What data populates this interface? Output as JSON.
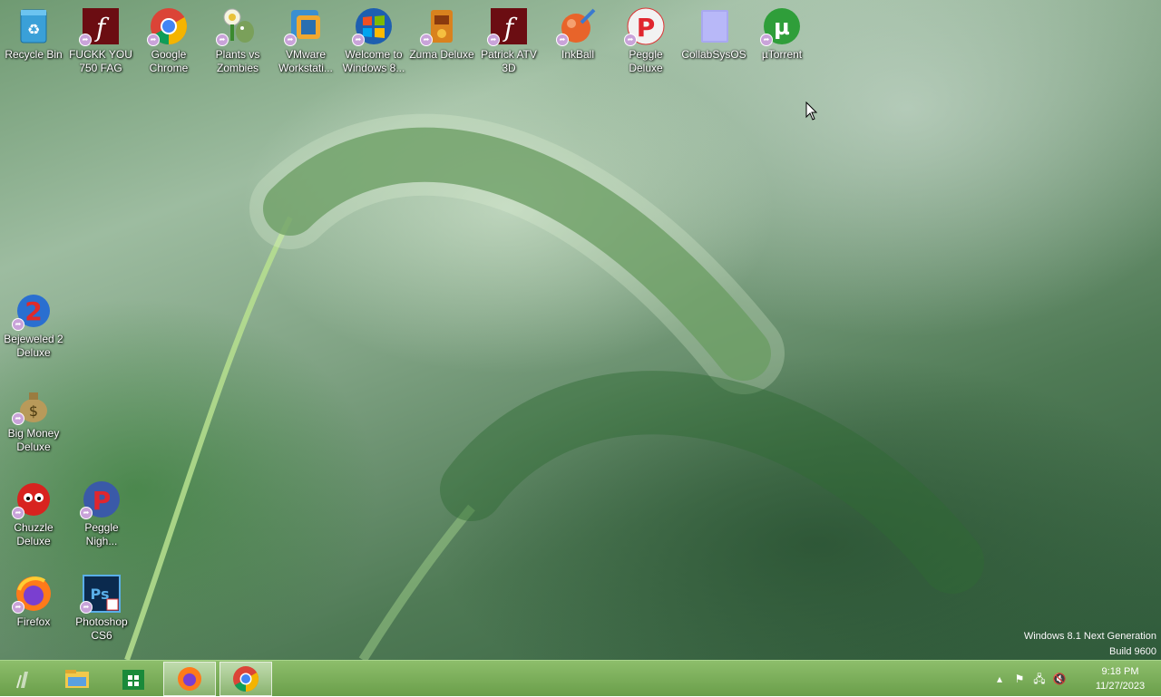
{
  "desktop": {
    "icons": [
      {
        "label": "Recycle Bin",
        "icon": "recycle-bin-icon"
      },
      {
        "label": "FUCKK YOU\n750 FAG",
        "icon": "flash-icon"
      },
      {
        "label": "Google\nChrome",
        "icon": "chrome-icon"
      },
      {
        "label": "Plants vs\nZombies",
        "icon": "plants-vs-zombies-icon"
      },
      {
        "label": "VMware\nWorkstati...",
        "icon": "vmware-icon"
      },
      {
        "label": "Welcome to\nWindows 8...",
        "icon": "windows-logo-icon"
      },
      {
        "label": "Zuma Deluxe",
        "icon": "zuma-icon"
      },
      {
        "label": "Patrick ATV\n3D",
        "icon": "flash-icon"
      },
      {
        "label": "InkBall",
        "icon": "inkball-icon"
      },
      {
        "label": "Peggle\nDeluxe",
        "icon": "peggle-icon"
      },
      {
        "label": "CollabSysOS",
        "icon": "folder-icon"
      },
      {
        "label": "µTorrent",
        "icon": "utorrent-icon"
      },
      {
        "label": "Bejeweled 2\nDeluxe",
        "icon": "bejeweled-icon"
      },
      {
        "label": "Big Money\nDeluxe",
        "icon": "money-bag-icon"
      },
      {
        "label": "Chuzzle\nDeluxe",
        "icon": "chuzzle-icon"
      },
      {
        "label": "Peggle\nNigh...",
        "icon": "peggle-icon"
      },
      {
        "label": "Firefox",
        "icon": "firefox-icon"
      },
      {
        "label": "Photoshop\nCS6",
        "icon": "photoshop-icon"
      }
    ]
  },
  "watermark": {
    "line1": "Windows 8.1 Next Generation",
    "line2": "Build 9600"
  },
  "taskbar": {
    "start_icon": "start-orb-icon",
    "pinned": [
      {
        "name": "file-explorer",
        "icon": "folder-icon",
        "active": false
      },
      {
        "name": "store",
        "icon": "store-icon",
        "active": false
      },
      {
        "name": "firefox",
        "icon": "firefox-icon",
        "active": true
      },
      {
        "name": "chrome",
        "icon": "chrome-icon",
        "active": true
      }
    ],
    "tray": {
      "icons": [
        "show-hidden-icon",
        "flag-icon",
        "network-icon",
        "volume-muted-icon"
      ]
    },
    "clock": {
      "time": "9:18 PM",
      "date": "11/27/2023"
    }
  },
  "colors": {
    "taskbar": "#7aae5a",
    "accent": "#8dbe6b"
  }
}
